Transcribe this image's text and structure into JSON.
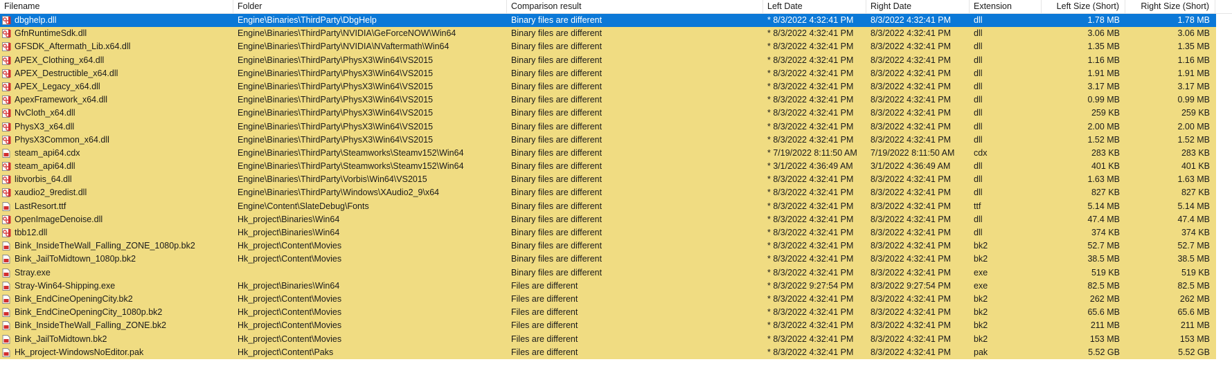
{
  "columns": [
    {
      "key": "filename",
      "label": "Filename"
    },
    {
      "key": "folder",
      "label": "Folder"
    },
    {
      "key": "result",
      "label": "Comparison result"
    },
    {
      "key": "left_date",
      "label": "Left Date"
    },
    {
      "key": "right_date",
      "label": "Right Date"
    },
    {
      "key": "ext",
      "label": "Extension"
    },
    {
      "key": "left_size",
      "label": "Left Size (Short)"
    },
    {
      "key": "right_size",
      "label": "Right Size (Short)"
    }
  ],
  "colors": {
    "row_bg": "#f0dc82",
    "selected_bg": "#0b78d7",
    "icon_red": "#d32f2f"
  },
  "icons": {
    "file_dll": "dll-file-icon",
    "file_other": "file-icon"
  },
  "selected_index": 0,
  "rows": [
    {
      "icon": "dll",
      "filename": "dbghelp.dll",
      "folder": "Engine\\Binaries\\ThirdParty\\DbgHelp",
      "result": "Binary files are different",
      "left_date": "* 8/3/2022 4:32:41 PM",
      "right_date": "8/3/2022 4:32:41 PM",
      "ext": "dll",
      "left_size": "1.78 MB",
      "right_size": "1.78 MB"
    },
    {
      "icon": "dll",
      "filename": "GfnRuntimeSdk.dll",
      "folder": "Engine\\Binaries\\ThirdParty\\NVIDIA\\GeForceNOW\\Win64",
      "result": "Binary files are different",
      "left_date": "* 8/3/2022 4:32:41 PM",
      "right_date": "8/3/2022 4:32:41 PM",
      "ext": "dll",
      "left_size": "3.06 MB",
      "right_size": "3.06 MB"
    },
    {
      "icon": "dll",
      "filename": "GFSDK_Aftermath_Lib.x64.dll",
      "folder": "Engine\\Binaries\\ThirdParty\\NVIDIA\\NVaftermath\\Win64",
      "result": "Binary files are different",
      "left_date": "* 8/3/2022 4:32:41 PM",
      "right_date": "8/3/2022 4:32:41 PM",
      "ext": "dll",
      "left_size": "1.35 MB",
      "right_size": "1.35 MB"
    },
    {
      "icon": "dll",
      "filename": "APEX_Clothing_x64.dll",
      "folder": "Engine\\Binaries\\ThirdParty\\PhysX3\\Win64\\VS2015",
      "result": "Binary files are different",
      "left_date": "* 8/3/2022 4:32:41 PM",
      "right_date": "8/3/2022 4:32:41 PM",
      "ext": "dll",
      "left_size": "1.16 MB",
      "right_size": "1.16 MB"
    },
    {
      "icon": "dll",
      "filename": "APEX_Destructible_x64.dll",
      "folder": "Engine\\Binaries\\ThirdParty\\PhysX3\\Win64\\VS2015",
      "result": "Binary files are different",
      "left_date": "* 8/3/2022 4:32:41 PM",
      "right_date": "8/3/2022 4:32:41 PM",
      "ext": "dll",
      "left_size": "1.91 MB",
      "right_size": "1.91 MB"
    },
    {
      "icon": "dll",
      "filename": "APEX_Legacy_x64.dll",
      "folder": "Engine\\Binaries\\ThirdParty\\PhysX3\\Win64\\VS2015",
      "result": "Binary files are different",
      "left_date": "* 8/3/2022 4:32:41 PM",
      "right_date": "8/3/2022 4:32:41 PM",
      "ext": "dll",
      "left_size": "3.17 MB",
      "right_size": "3.17 MB"
    },
    {
      "icon": "dll",
      "filename": "ApexFramework_x64.dll",
      "folder": "Engine\\Binaries\\ThirdParty\\PhysX3\\Win64\\VS2015",
      "result": "Binary files are different",
      "left_date": "* 8/3/2022 4:32:41 PM",
      "right_date": "8/3/2022 4:32:41 PM",
      "ext": "dll",
      "left_size": "0.99 MB",
      "right_size": "0.99 MB"
    },
    {
      "icon": "dll",
      "filename": "NvCloth_x64.dll",
      "folder": "Engine\\Binaries\\ThirdParty\\PhysX3\\Win64\\VS2015",
      "result": "Binary files are different",
      "left_date": "* 8/3/2022 4:32:41 PM",
      "right_date": "8/3/2022 4:32:41 PM",
      "ext": "dll",
      "left_size": "259 KB",
      "right_size": "259 KB"
    },
    {
      "icon": "dll",
      "filename": "PhysX3_x64.dll",
      "folder": "Engine\\Binaries\\ThirdParty\\PhysX3\\Win64\\VS2015",
      "result": "Binary files are different",
      "left_date": "* 8/3/2022 4:32:41 PM",
      "right_date": "8/3/2022 4:32:41 PM",
      "ext": "dll",
      "left_size": "2.00 MB",
      "right_size": "2.00 MB"
    },
    {
      "icon": "dll",
      "filename": "PhysX3Common_x64.dll",
      "folder": "Engine\\Binaries\\ThirdParty\\PhysX3\\Win64\\VS2015",
      "result": "Binary files are different",
      "left_date": "* 8/3/2022 4:32:41 PM",
      "right_date": "8/3/2022 4:32:41 PM",
      "ext": "dll",
      "left_size": "1.52 MB",
      "right_size": "1.52 MB"
    },
    {
      "icon": "file",
      "filename": "steam_api64.cdx",
      "folder": "Engine\\Binaries\\ThirdParty\\Steamworks\\Steamv152\\Win64",
      "result": "Binary files are different",
      "left_date": "* 7/19/2022 8:11:50 AM",
      "right_date": "7/19/2022 8:11:50 AM",
      "ext": "cdx",
      "left_size": "283 KB",
      "right_size": "283 KB"
    },
    {
      "icon": "dll",
      "filename": "steam_api64.dll",
      "folder": "Engine\\Binaries\\ThirdParty\\Steamworks\\Steamv152\\Win64",
      "result": "Binary files are different",
      "left_date": "* 3/1/2022 4:36:49 AM",
      "right_date": "3/1/2022 4:36:49 AM",
      "ext": "dll",
      "left_size": "401 KB",
      "right_size": "401 KB"
    },
    {
      "icon": "dll",
      "filename": "libvorbis_64.dll",
      "folder": "Engine\\Binaries\\ThirdParty\\Vorbis\\Win64\\VS2015",
      "result": "Binary files are different",
      "left_date": "* 8/3/2022 4:32:41 PM",
      "right_date": "8/3/2022 4:32:41 PM",
      "ext": "dll",
      "left_size": "1.63 MB",
      "right_size": "1.63 MB"
    },
    {
      "icon": "dll",
      "filename": "xaudio2_9redist.dll",
      "folder": "Engine\\Binaries\\ThirdParty\\Windows\\XAudio2_9\\x64",
      "result": "Binary files are different",
      "left_date": "* 8/3/2022 4:32:41 PM",
      "right_date": "8/3/2022 4:32:41 PM",
      "ext": "dll",
      "left_size": "827 KB",
      "right_size": "827 KB"
    },
    {
      "icon": "file",
      "filename": "LastResort.ttf",
      "folder": "Engine\\Content\\SlateDebug\\Fonts",
      "result": "Binary files are different",
      "left_date": "* 8/3/2022 4:32:41 PM",
      "right_date": "8/3/2022 4:32:41 PM",
      "ext": "ttf",
      "left_size": "5.14 MB",
      "right_size": "5.14 MB"
    },
    {
      "icon": "dll",
      "filename": "OpenImageDenoise.dll",
      "folder": "Hk_project\\Binaries\\Win64",
      "result": "Binary files are different",
      "left_date": "* 8/3/2022 4:32:41 PM",
      "right_date": "8/3/2022 4:32:41 PM",
      "ext": "dll",
      "left_size": "47.4 MB",
      "right_size": "47.4 MB"
    },
    {
      "icon": "dll",
      "filename": "tbb12.dll",
      "folder": "Hk_project\\Binaries\\Win64",
      "result": "Binary files are different",
      "left_date": "* 8/3/2022 4:32:41 PM",
      "right_date": "8/3/2022 4:32:41 PM",
      "ext": "dll",
      "left_size": "374 KB",
      "right_size": "374 KB"
    },
    {
      "icon": "file",
      "filename": "Bink_InsideTheWall_Falling_ZONE_1080p.bk2",
      "folder": "Hk_project\\Content\\Movies",
      "result": "Binary files are different",
      "left_date": "* 8/3/2022 4:32:41 PM",
      "right_date": "8/3/2022 4:32:41 PM",
      "ext": "bk2",
      "left_size": "52.7 MB",
      "right_size": "52.7 MB"
    },
    {
      "icon": "file",
      "filename": "Bink_JailToMidtown_1080p.bk2",
      "folder": "Hk_project\\Content\\Movies",
      "result": "Binary files are different",
      "left_date": "* 8/3/2022 4:32:41 PM",
      "right_date": "8/3/2022 4:32:41 PM",
      "ext": "bk2",
      "left_size": "38.5 MB",
      "right_size": "38.5 MB"
    },
    {
      "icon": "file",
      "filename": "Stray.exe",
      "folder": "",
      "result": "Binary files are different",
      "left_date": "* 8/3/2022 4:32:41 PM",
      "right_date": "8/3/2022 4:32:41 PM",
      "ext": "exe",
      "left_size": "519 KB",
      "right_size": "519 KB"
    },
    {
      "icon": "file",
      "filename": "Stray-Win64-Shipping.exe",
      "folder": "Hk_project\\Binaries\\Win64",
      "result": "Files are different",
      "left_date": "* 8/3/2022 9:27:54 PM",
      "right_date": "8/3/2022 9:27:54 PM",
      "ext": "exe",
      "left_size": "82.5 MB",
      "right_size": "82.5 MB"
    },
    {
      "icon": "file",
      "filename": "Bink_EndCineOpeningCity.bk2",
      "folder": "Hk_project\\Content\\Movies",
      "result": "Files are different",
      "left_date": "* 8/3/2022 4:32:41 PM",
      "right_date": "8/3/2022 4:32:41 PM",
      "ext": "bk2",
      "left_size": "262 MB",
      "right_size": "262 MB"
    },
    {
      "icon": "file",
      "filename": "Bink_EndCineOpeningCity_1080p.bk2",
      "folder": "Hk_project\\Content\\Movies",
      "result": "Files are different",
      "left_date": "* 8/3/2022 4:32:41 PM",
      "right_date": "8/3/2022 4:32:41 PM",
      "ext": "bk2",
      "left_size": "65.6 MB",
      "right_size": "65.6 MB"
    },
    {
      "icon": "file",
      "filename": "Bink_InsideTheWall_Falling_ZONE.bk2",
      "folder": "Hk_project\\Content\\Movies",
      "result": "Files are different",
      "left_date": "* 8/3/2022 4:32:41 PM",
      "right_date": "8/3/2022 4:32:41 PM",
      "ext": "bk2",
      "left_size": "211 MB",
      "right_size": "211 MB"
    },
    {
      "icon": "file",
      "filename": "Bink_JailToMidtown.bk2",
      "folder": "Hk_project\\Content\\Movies",
      "result": "Files are different",
      "left_date": "* 8/3/2022 4:32:41 PM",
      "right_date": "8/3/2022 4:32:41 PM",
      "ext": "bk2",
      "left_size": "153 MB",
      "right_size": "153 MB"
    },
    {
      "icon": "file",
      "filename": "Hk_project-WindowsNoEditor.pak",
      "folder": "Hk_project\\Content\\Paks",
      "result": "Files are different",
      "left_date": "* 8/3/2022 4:32:41 PM",
      "right_date": "8/3/2022 4:32:41 PM",
      "ext": "pak",
      "left_size": "5.52 GB",
      "right_size": "5.52 GB"
    }
  ]
}
